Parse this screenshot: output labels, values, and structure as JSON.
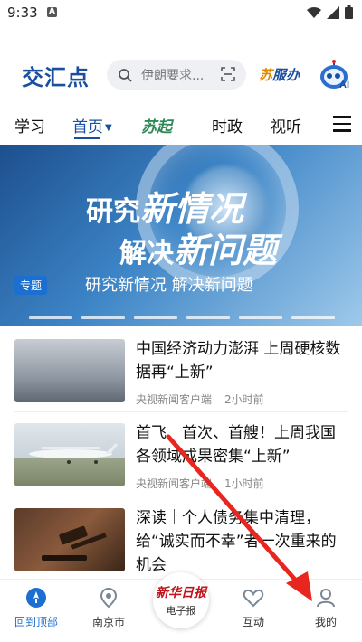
{
  "status": {
    "time": "9:33"
  },
  "header": {
    "logo": "交汇点",
    "search_placeholder": "伊朗要求...",
    "sufu_part1": "苏",
    "sufu_part2": "服办",
    "ai_label": "AI"
  },
  "tabs": [
    {
      "label": "学习"
    },
    {
      "label": "首页"
    },
    {
      "label": "苏起"
    },
    {
      "label": "时政"
    },
    {
      "label": "视听"
    }
  ],
  "banner": {
    "line1_a": "研究",
    "line1_b": "新情况",
    "line2_a": "解决",
    "line2_b": "新问题",
    "tag": "专题",
    "caption": "研究新情况 解决新问题"
  },
  "news": [
    {
      "title": "中国经济动力澎湃 上周硬核数据再“上新”",
      "source": "央视新闻客户端",
      "time": "2小时前"
    },
    {
      "title": "首飞、首次、首艘！上周我国各领域成果密集“上新”",
      "source": "央视新闻客户端",
      "time": "1小时前"
    },
    {
      "title": "深读｜个人债务集中清理，给“诚实而不幸”者一次重来的机会",
      "source": "",
      "time": ""
    }
  ],
  "bottom_nav": [
    {
      "label": "回到顶部"
    },
    {
      "label": "南京市"
    },
    {
      "label": "电子报",
      "badge": "新华日报"
    },
    {
      "label": "互动"
    },
    {
      "label": "我的"
    }
  ],
  "colors": {
    "brand_blue": "#1a4fa0",
    "accent_blue": "#1a6fd0",
    "arrow_red": "#e8261f"
  }
}
